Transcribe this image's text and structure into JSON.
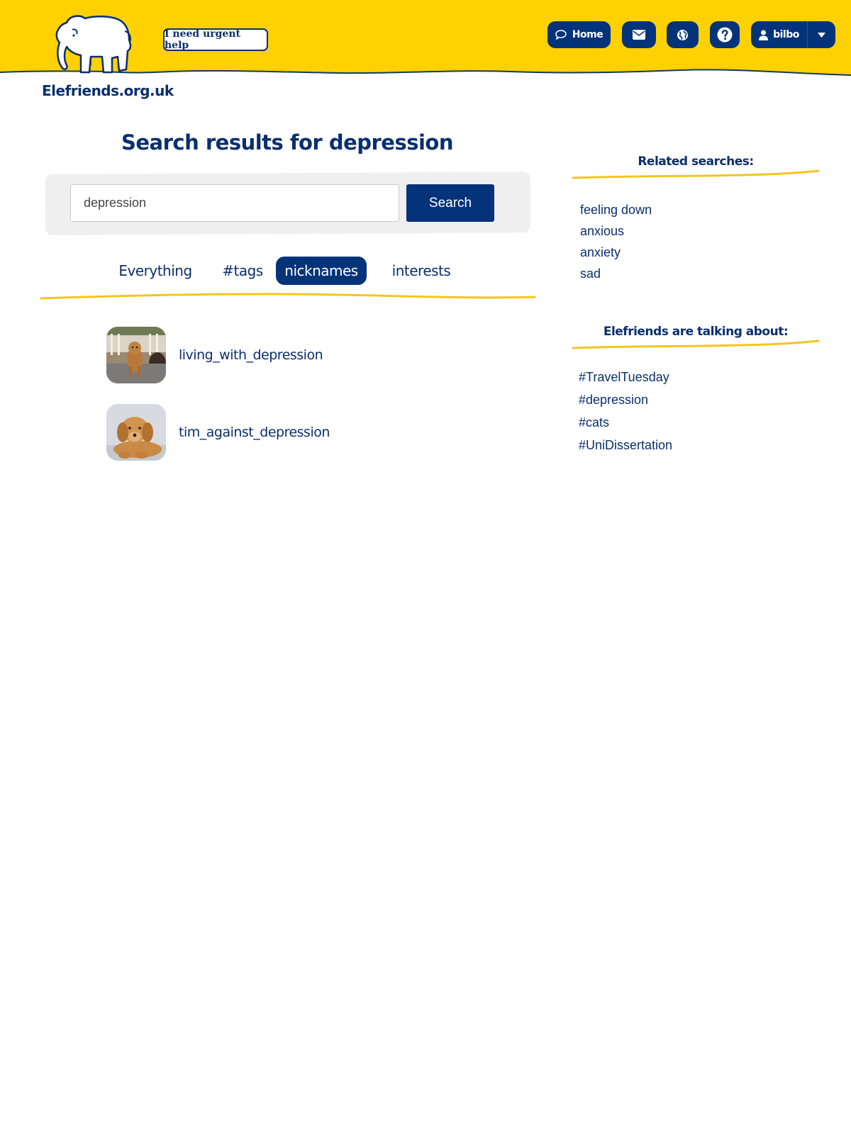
{
  "header": {
    "site_name": "Elefriends.org.uk",
    "urgent_help_label": "I need urgent help",
    "nav": {
      "home_label": "Home",
      "home_icon": "speech-bubble-icon",
      "mail_icon": "envelope-icon",
      "globe_icon": "globe-icon",
      "help_icon": "question-circle-icon",
      "user_label": "bilbo",
      "user_icon": "user-icon",
      "dropdown_icon": "caret-down-icon"
    }
  },
  "main": {
    "title": "Search results for depression",
    "search": {
      "value": "depression",
      "button_label": "Search"
    },
    "tabs": [
      {
        "label": "Everything",
        "active": false
      },
      {
        "label": "#tags",
        "active": false
      },
      {
        "label": "nicknames",
        "active": true
      },
      {
        "label": "interests",
        "active": false
      }
    ],
    "results": [
      {
        "name": "living_with_depression"
      },
      {
        "name": "tim_against_depression"
      }
    ]
  },
  "sidebar": {
    "related_heading": "Related searches:",
    "related": [
      "feeling down",
      "anxious",
      "anxiety",
      "sad"
    ],
    "trending_heading": "Elefriends are talking about:",
    "trending": [
      "#TravelTuesday",
      "#depression",
      "#cats",
      "#UniDissertation"
    ]
  },
  "colors": {
    "brand_yellow": "#ffd100",
    "brand_navy": "#04337a",
    "text_navy": "#0a2f6e",
    "panel_grey": "#efefef"
  }
}
